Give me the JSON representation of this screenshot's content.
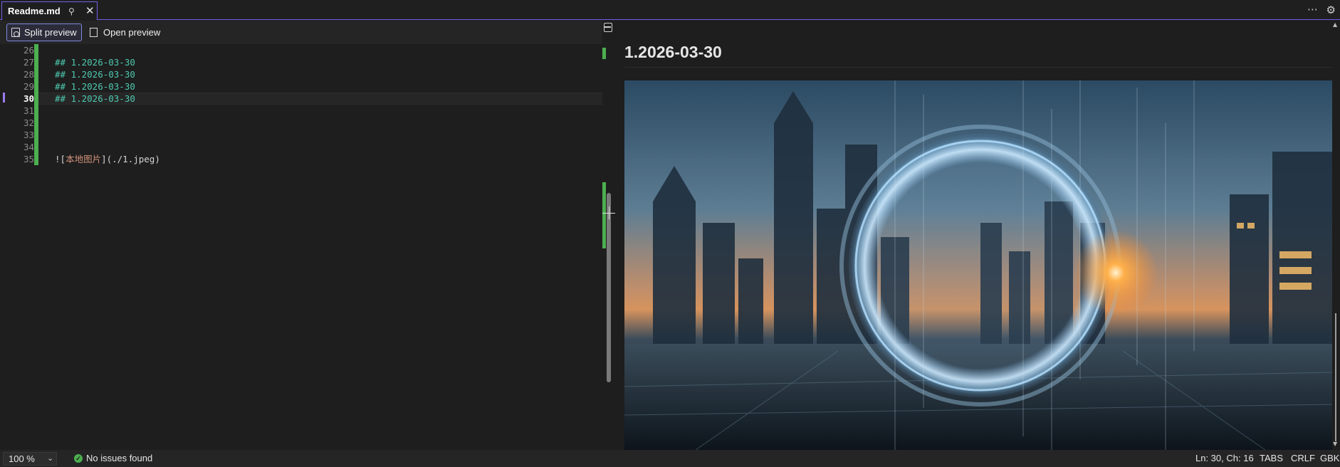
{
  "tab": {
    "title": "Readme.md",
    "pin_icon": "pin-icon",
    "close_icon": "close-icon"
  },
  "window": {
    "more_icon": "more-icon",
    "settings_icon": "gear-icon"
  },
  "toolbar": {
    "split_preview_label": "Split preview",
    "open_preview_label": "Open preview"
  },
  "editor": {
    "lines": [
      {
        "number": "26",
        "text": ""
      },
      {
        "number": "27",
        "text": "## 1.2026-03-30"
      },
      {
        "number": "28",
        "text": "## 1.2026-03-30"
      },
      {
        "number": "29",
        "text": "## 1.2026-03-30"
      },
      {
        "number": "30",
        "text": "## 1.2026-03-30",
        "current": true
      },
      {
        "number": "31",
        "text": ""
      },
      {
        "number": "32",
        "text": ""
      },
      {
        "number": "33",
        "text": ""
      },
      {
        "number": "34",
        "text": ""
      },
      {
        "number": "35",
        "text": ""
      }
    ],
    "image_line": {
      "prefix": "![",
      "alt": "本地图片",
      "suffix": "](./1.jpeg)"
    }
  },
  "preview": {
    "heading": "1.2026-03-30",
    "image_description": "futuristic-city-portal-image"
  },
  "statusbar": {
    "zoom": "100 %",
    "issues": "No issues found",
    "position": "Ln: 30, Ch: 16",
    "indent": "TABS",
    "line_ending": "CRLF",
    "encoding": "GBK"
  },
  "colors": {
    "accent": "#7160e8",
    "change_bar": "#4caf50",
    "heading_code": "#4ec9b0",
    "string": "#ce9178"
  }
}
